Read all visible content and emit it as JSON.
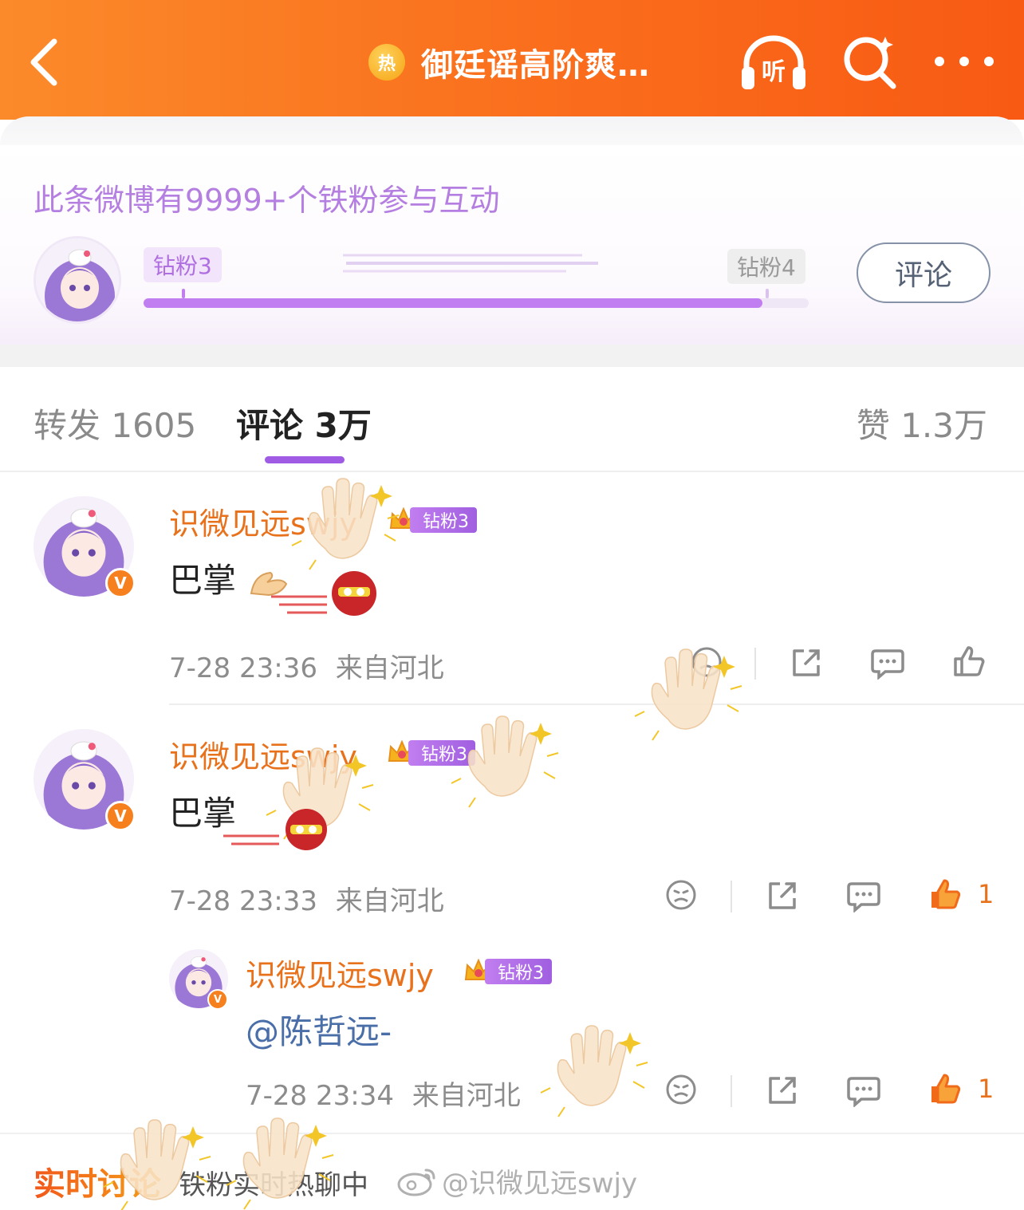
{
  "header": {
    "back_label": "back",
    "hot_badge": "热",
    "title": "御廷谣高阶爽…",
    "listen_label": "听"
  },
  "fans_card": {
    "headline": "此条微博有9999+个铁粉参与互动",
    "level_current": "钻粉3",
    "level_next": "钻粉4",
    "progress": 0.93,
    "comment_button": "评论"
  },
  "tabs": {
    "repost": "转发 1605",
    "comment": "评论 3万",
    "like": "赞 1.3万"
  },
  "comments": [
    {
      "username": "识微见远swjy",
      "fan_level": "钻粉3",
      "text": "巴掌",
      "time": "7-28 23:36",
      "location": "来自河北",
      "likes": ""
    },
    {
      "username": "识微见远swjy",
      "fan_level": "钻粉3",
      "text": "巴掌",
      "time": "7-28 23:33",
      "location": "来自河北",
      "likes": "1"
    }
  ],
  "reply": {
    "username": "识微见远swjy",
    "fan_level": "钻粉3",
    "text": "@陈哲远-",
    "time": "7-28 23:34",
    "location": "来自河北",
    "likes": "1"
  },
  "bottom_bar": {
    "title": "实时讨论",
    "subtitle": "铁粉实时热聊中",
    "watermark": "@识微见远swjy"
  },
  "colors": {
    "header_orange": "#fa6d1c",
    "fan_purple": "#b47fe0",
    "username_orange": "#e8711c",
    "mention_blue": "#4a6ea8"
  },
  "icons": [
    "back-icon",
    "fire-icon",
    "headphones-icon",
    "search-icon",
    "more-icon",
    "dislike-icon",
    "share-icon",
    "comment-icon",
    "like-icon",
    "crown-icon",
    "verified-icon",
    "clap-emoji-icon",
    "waving-hand-icon",
    "weibo-logo-icon"
  ]
}
